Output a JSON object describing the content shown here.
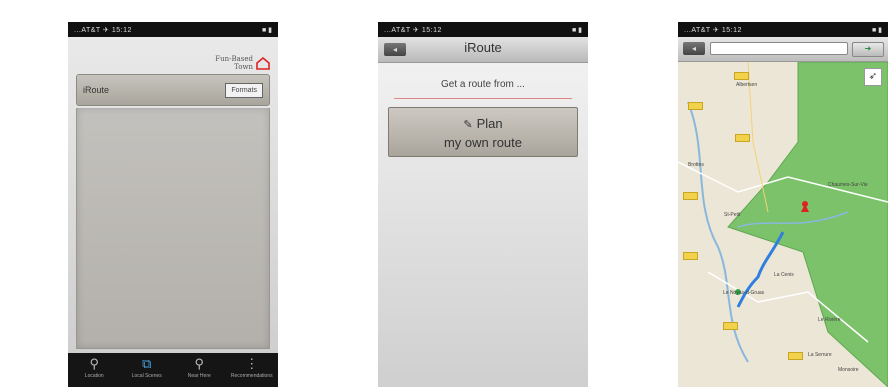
{
  "status_bar": {
    "carrier": "...AT&T  ✈  15:12",
    "battery": "■ ▮"
  },
  "screen1": {
    "brand_line1": "Fun-Based",
    "brand_line2": "Town",
    "menu_label": "iRoute",
    "menu_button": "Formats",
    "tabs": [
      {
        "label": "Location",
        "icon": "pin-icon"
      },
      {
        "label": "Local Scenes",
        "icon": "route-icon"
      },
      {
        "label": "Near Here",
        "icon": "search-icon"
      },
      {
        "label": "Recommendations",
        "icon": "more-icon"
      }
    ]
  },
  "screen2": {
    "title": "iRoute",
    "back": "◂",
    "hint": "Get a route from ...",
    "plan_line1": "Plan",
    "plan_line2": "my own route",
    "pen_icon": "✎"
  },
  "screen3": {
    "back": "◂",
    "search_value": "",
    "go": "➜",
    "map_labels": [
      "Albertsen",
      "St-Petit",
      "La Cenis",
      "Le Noyau-d-Gruas",
      "Le Rivière",
      "La Serrure",
      "Brottes",
      "Chaumes-Sur-Vie",
      "Monsoire"
    ]
  }
}
